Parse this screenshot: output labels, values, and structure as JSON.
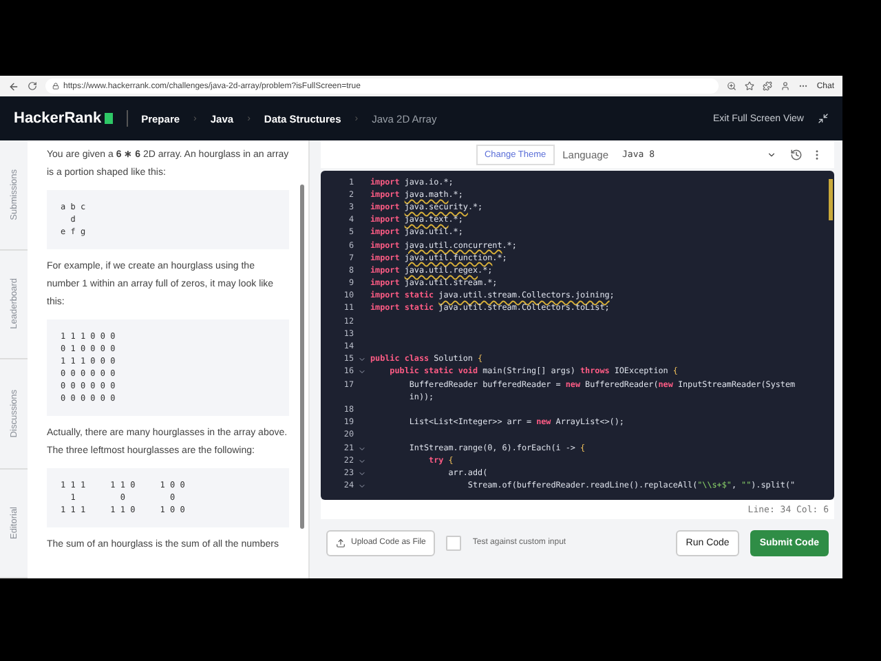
{
  "browser": {
    "url": "https://www.hackerrank.com/challenges/java-2d-array/problem?isFullScreen=true",
    "chat": "Chat"
  },
  "header": {
    "logo": "HackerRank",
    "breadcrumbs": [
      {
        "label": "Prepare",
        "current": false
      },
      {
        "separator": "›",
        "label": "Java",
        "current": false
      },
      {
        "separator": "›",
        "label": "Data Structures",
        "current": false
      },
      {
        "separator": "›",
        "label": "Java 2D Array",
        "current": true
      }
    ],
    "exit_label": "Exit Full Screen View"
  },
  "side_tabs": [
    "Submissions",
    "Leaderboard",
    "Discussions",
    "Editorial"
  ],
  "problem": {
    "blocks": [
      {
        "kind": "text",
        "text": "You are given a **6 ∗ 6** 2D array. An hourglass in an array is a portion shaped like this:"
      },
      {
        "kind": "code",
        "lines": [
          "a b c",
          "  d",
          "e f g"
        ]
      },
      {
        "kind": "text",
        "text": "For example, if we create an hourglass using the number 1 within an array full of zeros, it may look like this:"
      },
      {
        "kind": "code",
        "lines": [
          "1 1 1 0 0 0",
          "0 1 0 0 0 0",
          "1 1 1 0 0 0",
          "0 0 0 0 0 0",
          "0 0 0 0 0 0",
          "0 0 0 0 0 0"
        ]
      },
      {
        "kind": "text",
        "text": "Actually, there are many hourglasses in the array above. The three leftmost hourglasses are the following:"
      },
      {
        "kind": "code",
        "lines": [
          "1 1 1     1 1 0     1 0 0",
          "  1         0         0",
          "1 1 1     1 1 0     1 0 0"
        ]
      },
      {
        "kind": "text",
        "text": "The sum of an hourglass is the sum of all the numbers"
      }
    ]
  },
  "toolbar": {
    "theme_button": "Change Theme",
    "language_label": "Language",
    "language": "Java 8"
  },
  "editor": {
    "lines": [
      {
        "number": "1",
        "foldable": false,
        "tokens": [
          {
            "kind": "keyword",
            "text": "import "
          },
          {
            "kind": "plain",
            "text": "java.io.*;"
          }
        ]
      },
      {
        "number": "2",
        "foldable": false,
        "tokens": [
          {
            "kind": "keyword",
            "text": "import "
          },
          {
            "kind": "warning",
            "text": "java.math"
          },
          {
            "kind": "plain",
            "text": ".*;"
          }
        ]
      },
      {
        "number": "3",
        "foldable": false,
        "tokens": [
          {
            "kind": "keyword",
            "text": "import "
          },
          {
            "kind": "warning",
            "text": "java.security"
          },
          {
            "kind": "plain",
            "text": ".*;"
          }
        ]
      },
      {
        "number": "4",
        "foldable": false,
        "tokens": [
          {
            "kind": "keyword",
            "text": "import "
          },
          {
            "kind": "warning",
            "text": "java.text"
          },
          {
            "kind": "plain",
            "text": ".*;"
          }
        ]
      },
      {
        "number": "5",
        "foldable": false,
        "tokens": [
          {
            "kind": "keyword",
            "text": "import "
          },
          {
            "kind": "plain",
            "text": "java.util.*;"
          }
        ]
      },
      {
        "number": "6",
        "foldable": false,
        "tokens": [
          {
            "kind": "keyword",
            "text": "import "
          },
          {
            "kind": "warning",
            "text": "java.util.concurrent"
          },
          {
            "kind": "plain",
            "text": ".*;"
          }
        ]
      },
      {
        "number": "7",
        "foldable": false,
        "tokens": [
          {
            "kind": "keyword",
            "text": "import "
          },
          {
            "kind": "warning",
            "text": "java.util.function"
          },
          {
            "kind": "plain",
            "text": ".*;"
          }
        ]
      },
      {
        "number": "8",
        "foldable": false,
        "tokens": [
          {
            "kind": "keyword",
            "text": "import "
          },
          {
            "kind": "warning",
            "text": "java.util.regex"
          },
          {
            "kind": "plain",
            "text": ".*;"
          }
        ]
      },
      {
        "number": "9",
        "foldable": false,
        "tokens": [
          {
            "kind": "keyword",
            "text": "import "
          },
          {
            "kind": "plain",
            "text": "java.util.stream.*;"
          }
        ]
      },
      {
        "number": "10",
        "foldable": false,
        "tokens": [
          {
            "kind": "keyword",
            "text": "import static "
          },
          {
            "kind": "warning",
            "text": "java.util.stream.Collectors.joining"
          },
          {
            "kind": "plain",
            "text": ";"
          }
        ]
      },
      {
        "number": "11",
        "foldable": false,
        "tokens": [
          {
            "kind": "keyword",
            "text": "import static "
          },
          {
            "kind": "plain",
            "text": "java.util.stream.Collectors.toList;"
          }
        ]
      },
      {
        "number": "12",
        "foldable": false
      },
      {
        "number": "13",
        "foldable": false
      },
      {
        "number": "14",
        "foldable": false
      },
      {
        "number": "15",
        "foldable": true,
        "tokens": [
          {
            "kind": "keyword",
            "text": "public class "
          },
          {
            "kind": "plain",
            "text": "Solution "
          },
          {
            "kind": "bracket",
            "text": "{"
          }
        ]
      },
      {
        "number": "16",
        "foldable": true,
        "tokens": [
          {
            "kind": "keyword",
            "text": "    public static void "
          },
          {
            "kind": "plain",
            "text": "main(String[] args) "
          },
          {
            "kind": "keyword",
            "text": "throws "
          },
          {
            "kind": "plain",
            "text": "IOException "
          },
          {
            "kind": "bracket",
            "text": "{"
          }
        ]
      },
      {
        "number": "17",
        "foldable": false,
        "tokens": [
          {
            "kind": "plain",
            "text": "        BufferedReader bufferedReader = "
          },
          {
            "kind": "keyword",
            "text": "new "
          },
          {
            "kind": "plain",
            "text": "BufferedReader("
          },
          {
            "kind": "keyword",
            "text": "new "
          },
          {
            "kind": "plain",
            "text": "InputStreamReader(System"
          }
        ],
        "continuation": [
          {
            "kind": "plain",
            "text": "        in));"
          }
        ]
      },
      {
        "number": "18",
        "foldable": false
      },
      {
        "number": "19",
        "foldable": false,
        "tokens": [
          {
            "kind": "plain",
            "text": "        List<List<Integer>> arr = "
          },
          {
            "kind": "keyword",
            "text": "new "
          },
          {
            "kind": "plain",
            "text": "ArrayList<>();"
          }
        ]
      },
      {
        "number": "20",
        "foldable": false
      },
      {
        "number": "21",
        "foldable": true,
        "tokens": [
          {
            "kind": "plain",
            "text": "        IntStream.range(0, 6).forEach(i -> "
          },
          {
            "kind": "bracket",
            "text": "{"
          }
        ]
      },
      {
        "number": "22",
        "foldable": true,
        "tokens": [
          {
            "kind": "keyword",
            "text": "            try "
          },
          {
            "kind": "bracket",
            "text": "{"
          }
        ]
      },
      {
        "number": "23",
        "foldable": true,
        "tokens": [
          {
            "kind": "plain",
            "text": "                arr.add("
          }
        ]
      },
      {
        "number": "24",
        "foldable": true,
        "tokens": [
          {
            "kind": "plain",
            "text": "                    Stream.of(bufferedReader.readLine().replaceAll("
          },
          {
            "kind": "string",
            "text": "\"\\\\s+$\""
          },
          {
            "kind": "plain",
            "text": ", "
          },
          {
            "kind": "string",
            "text": "\"\""
          },
          {
            "kind": "plain",
            "text": ").split(\""
          }
        ]
      }
    ],
    "status": "Line: 34 Col: 6"
  },
  "footer": {
    "upload": "Upload Code as File",
    "custom_input": {
      "label": "Test against custom input",
      "checked": false
    },
    "run": "Run Code",
    "submit": "Submit Code"
  }
}
